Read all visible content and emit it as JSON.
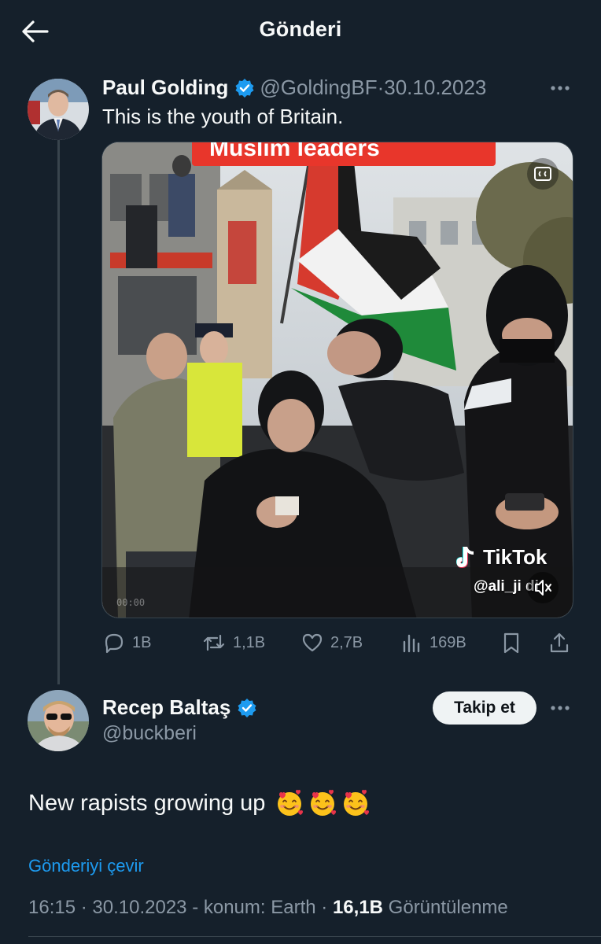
{
  "header": {
    "title": "Gönderi"
  },
  "post1": {
    "author_name": "Paul Golding",
    "handle": "@GoldingBF",
    "separator": " · ",
    "date": "30.10.2023",
    "text": "This is the youth of Britain.",
    "media": {
      "banner_text": "Muslim leaders",
      "watermark_brand": "TikTok",
      "watermark_handle": "@ali_ji  di",
      "timecode": "00:00"
    },
    "actions": {
      "replies": "1B",
      "reposts": "1,1B",
      "likes": "2,7B",
      "views": "169B"
    }
  },
  "post2": {
    "author_name": "Recep Baltaş",
    "handle": "@buckberi",
    "follow_label": "Takip et",
    "text": "New rapists growing up",
    "emoji": [
      "smiling-face-with-hearts",
      "smiling-face-with-hearts",
      "smiling-face-with-hearts"
    ],
    "translate_label": "Gönderiyi çevir",
    "time": "16:15",
    "date": "30.10.2023",
    "location": "- konum: Earth",
    "views_count": "16,1B",
    "views_label": "Görüntülenme"
  },
  "colors": {
    "background": "#15202b",
    "accent": "#1d9bf0",
    "secondary_text": "#8b98a5",
    "verified_badge": "#1d9bf0"
  }
}
